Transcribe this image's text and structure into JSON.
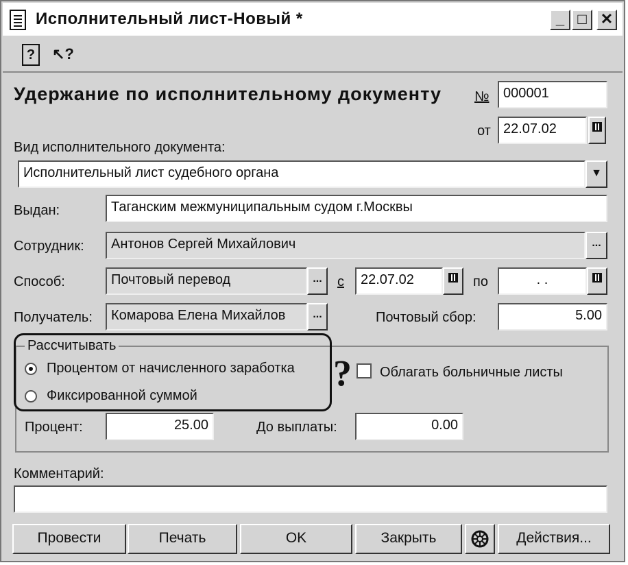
{
  "window": {
    "title": "Исполнительный лист-Новый *",
    "min_glyph": "_",
    "max_glyph": "□",
    "close_glyph": "✕"
  },
  "toolbar": {
    "help_glyph": "?",
    "pointer_help_glyph": "↖?"
  },
  "header": {
    "title": "Удержание по исполнительному документу",
    "number_label": "№",
    "number_value": "000001",
    "date_label": "от",
    "date_value": "22.07.02"
  },
  "doc_type": {
    "label": "Вид исполнительного документа:",
    "value": "Исполнительный лист судебного органа"
  },
  "issued": {
    "label": "Выдан:",
    "value": "Таганским межмуниципальным судом г.Москвы"
  },
  "employee": {
    "label": "Сотрудник:",
    "value": "Антонов Сергей Михайлович"
  },
  "method": {
    "label": "Способ:",
    "value": "Почтовый перевод",
    "from_label": "с",
    "from_value": "22.07.02",
    "to_label": "по",
    "to_value": ". ."
  },
  "recipient": {
    "label": "Получатель:",
    "value": "Комарова Елена Михайлов",
    "fee_label": "Почтовый сбор:",
    "fee_value": "5.00"
  },
  "calc": {
    "group_label": "Рассчитывать",
    "option_percent": "Процентом от начисленного заработка",
    "option_fixed": "Фиксированной суммой",
    "question_mark": "?",
    "sick_leave_label": "Облагать больничные листы",
    "percent_label": "Процент:",
    "percent_value": "25.00",
    "remaining_label": "До выплаты:",
    "remaining_value": "0.00"
  },
  "comment": {
    "label": "Комментарий:",
    "value": ""
  },
  "buttons": {
    "post": "Провести",
    "print": "Печать",
    "ok": "OK",
    "close": "Закрыть",
    "actions": "Действия..."
  }
}
